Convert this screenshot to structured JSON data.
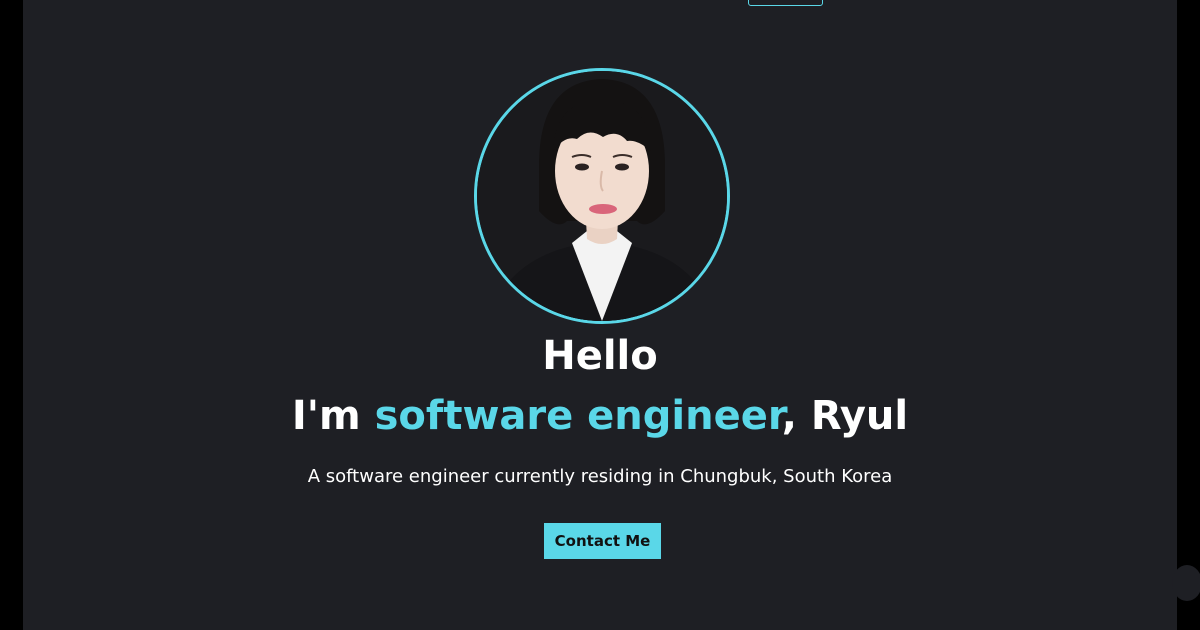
{
  "hero": {
    "greeting": "Hello",
    "headline_prefix": "I'm ",
    "headline_role": "software engineer",
    "headline_suffix": ", Ryul",
    "subtitle": "A software engineer currently residing in Chungbuk, South Korea",
    "contact_label": "Contact Me"
  },
  "colors": {
    "background": "#1e1f24",
    "accent": "#5ad7e8",
    "text": "#ffffff"
  },
  "icons": {
    "avatar": "profile-photo"
  }
}
